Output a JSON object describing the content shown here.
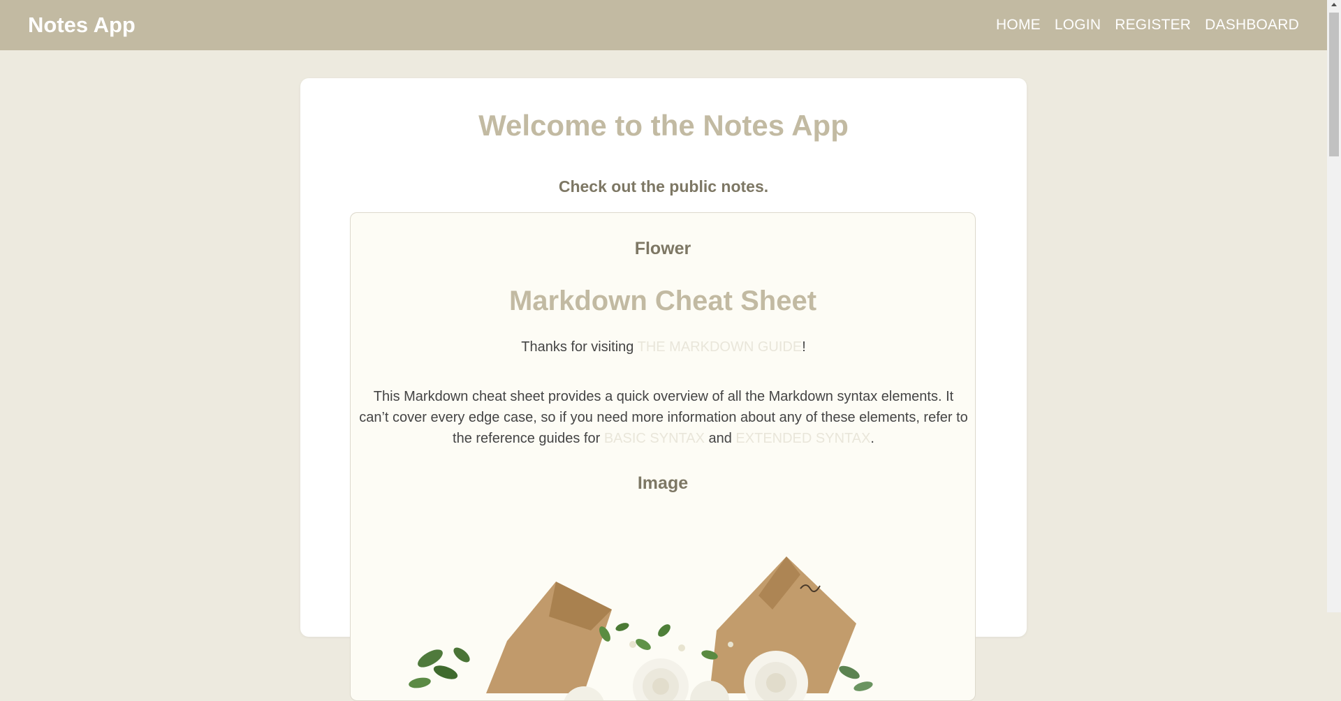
{
  "nav": {
    "brand": "Notes App",
    "links": [
      "HOME",
      "LOGIN",
      "REGISTER",
      "DASHBOARD"
    ]
  },
  "main": {
    "title": "Welcome to the Notes App",
    "subtitle": "Check out the public notes."
  },
  "note": {
    "title": "Flower",
    "heading": "Markdown Cheat Sheet",
    "p1_before": "Thanks for visiting ",
    "p1_link": "THE MARKDOWN GUIDE",
    "p1_after": "!",
    "p2_text1": "This Markdown cheat sheet provides a quick overview of all the Markdown syntax elements. It can’t cover every edge case, so if you need more information about any of these elements, refer to the reference guides for ",
    "p2_link1": "BASIC SYNTAX",
    "p2_text2": " and ",
    "p2_link2": "EXTENDED SYNTAX",
    "p2_text3": ".",
    "section_heading": "Image"
  },
  "colors": {
    "navbar": "#c2baa2",
    "page_bg": "#edeadf",
    "accent_heading": "#c2baa2",
    "dark_heading": "#7d7764",
    "link": "#e9e6da"
  }
}
